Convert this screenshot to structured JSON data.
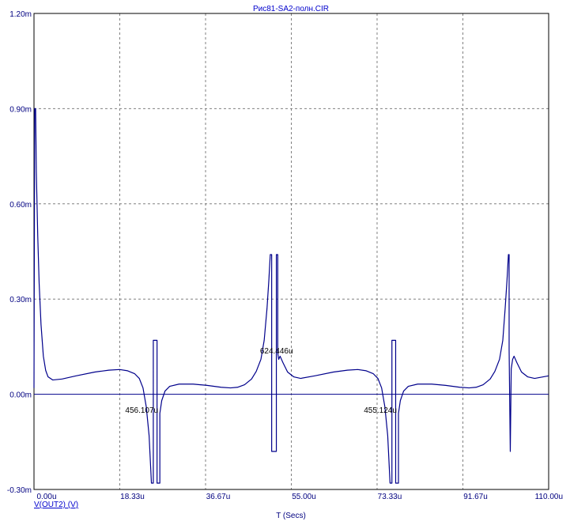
{
  "chart_data": {
    "type": "line",
    "title": "Рис81-SA2-полн.CIR",
    "xlabel": "T (Secs)",
    "trace_label": "V(OUT2) (V)",
    "xlim": [
      0,
      110
    ],
    "ylim": [
      -0.3,
      1.2
    ],
    "x_ticks": [
      0,
      18.33,
      36.67,
      55,
      73.33,
      91.67,
      110
    ],
    "x_tick_labels": [
      "0.00u",
      "18.33u",
      "36.67u",
      "55.00u",
      "73.33u",
      "91.67u",
      "110.00u"
    ],
    "y_ticks": [
      -0.3,
      0,
      0.3,
      0.6,
      0.9,
      1.2
    ],
    "y_tick_labels": [
      "-0.30m",
      "0.00m",
      "0.30m",
      "0.60m",
      "0.90m",
      "1.20m"
    ],
    "grid": true,
    "zero_line": true,
    "colors": {
      "trace": "#00008b",
      "grid": "#808080",
      "axis": "#000000",
      "text": "#000080"
    },
    "series": [
      {
        "name": "V(OUT2) (V)",
        "points": [
          [
            0,
            0.02
          ],
          [
            0.15,
            0.9
          ],
          [
            0.35,
            0.9
          ],
          [
            0.5,
            0.7
          ],
          [
            0.8,
            0.5
          ],
          [
            1.1,
            0.35
          ],
          [
            1.5,
            0.22
          ],
          [
            2,
            0.12
          ],
          [
            2.5,
            0.075
          ],
          [
            3,
            0.055
          ],
          [
            4,
            0.045
          ],
          [
            6,
            0.048
          ],
          [
            9,
            0.058
          ],
          [
            13,
            0.07
          ],
          [
            16,
            0.076
          ],
          [
            18.3,
            0.078
          ],
          [
            20,
            0.074
          ],
          [
            21.5,
            0.065
          ],
          [
            22.5,
            0.05
          ],
          [
            23.3,
            0.02
          ],
          [
            24,
            -0.04
          ],
          [
            24.6,
            -0.13
          ],
          [
            25.1,
            -0.28
          ],
          [
            25.5,
            -0.28
          ],
          [
            25.5,
            0.17
          ],
          [
            26.3,
            0.17
          ],
          [
            26.3,
            -0.28
          ],
          [
            26.9,
            -0.28
          ],
          [
            26.9,
            -0.06
          ],
          [
            27.3,
            -0.02
          ],
          [
            28,
            0.01
          ],
          [
            29,
            0.025
          ],
          [
            31,
            0.032
          ],
          [
            34,
            0.032
          ],
          [
            37,
            0.028
          ],
          [
            40,
            0.022
          ],
          [
            42,
            0.02
          ],
          [
            43.5,
            0.022
          ],
          [
            45,
            0.03
          ],
          [
            46.5,
            0.048
          ],
          [
            47.5,
            0.072
          ],
          [
            48.5,
            0.11
          ],
          [
            49.2,
            0.17
          ],
          [
            49.8,
            0.27
          ],
          [
            50.2,
            0.36
          ],
          [
            50.5,
            0.44
          ],
          [
            50.8,
            0.44
          ],
          [
            50.8,
            -0.18
          ],
          [
            51.8,
            -0.18
          ],
          [
            51.8,
            0.44
          ],
          [
            52.1,
            0.44
          ],
          [
            52.1,
            0.13
          ],
          [
            52.3,
            0.11
          ],
          [
            52.6,
            0.12
          ],
          [
            53.2,
            0.1
          ],
          [
            54.2,
            0.07
          ],
          [
            55.5,
            0.055
          ],
          [
            57,
            0.05
          ],
          [
            60,
            0.058
          ],
          [
            64,
            0.07
          ],
          [
            67,
            0.076
          ],
          [
            69.2,
            0.078
          ],
          [
            71,
            0.074
          ],
          [
            72.5,
            0.065
          ],
          [
            73.5,
            0.05
          ],
          [
            74.3,
            0.02
          ],
          [
            75,
            -0.04
          ],
          [
            75.6,
            -0.13
          ],
          [
            76.1,
            -0.28
          ],
          [
            76.5,
            -0.28
          ],
          [
            76.5,
            0.17
          ],
          [
            77.3,
            0.17
          ],
          [
            77.3,
            -0.28
          ],
          [
            77.9,
            -0.28
          ],
          [
            77.9,
            -0.06
          ],
          [
            78.3,
            -0.02
          ],
          [
            79,
            0.01
          ],
          [
            80,
            0.025
          ],
          [
            82,
            0.032
          ],
          [
            85,
            0.032
          ],
          [
            88,
            0.028
          ],
          [
            91,
            0.022
          ],
          [
            93,
            0.02
          ],
          [
            94.5,
            0.022
          ],
          [
            96,
            0.03
          ],
          [
            97.5,
            0.048
          ],
          [
            98.5,
            0.072
          ],
          [
            99.5,
            0.11
          ],
          [
            100.2,
            0.17
          ],
          [
            100.7,
            0.27
          ],
          [
            101.1,
            0.36
          ],
          [
            101.4,
            0.44
          ],
          [
            101.55,
            0.44
          ],
          [
            101.55,
            0.14
          ],
          [
            101.8,
            -0.18
          ],
          [
            102,
            0.08
          ],
          [
            102.3,
            0.11
          ],
          [
            102.6,
            0.12
          ],
          [
            103.2,
            0.1
          ],
          [
            104.2,
            0.07
          ],
          [
            105.5,
            0.055
          ],
          [
            107,
            0.05
          ],
          [
            110,
            0.058
          ]
        ]
      }
    ],
    "annotations": [
      {
        "text": "456.107u",
        "x": 19.5,
        "y": -0.058
      },
      {
        "text": "624.446u",
        "x": 48.3,
        "y": 0.128
      },
      {
        "text": "455.124u",
        "x": 70.5,
        "y": -0.058
      }
    ]
  }
}
